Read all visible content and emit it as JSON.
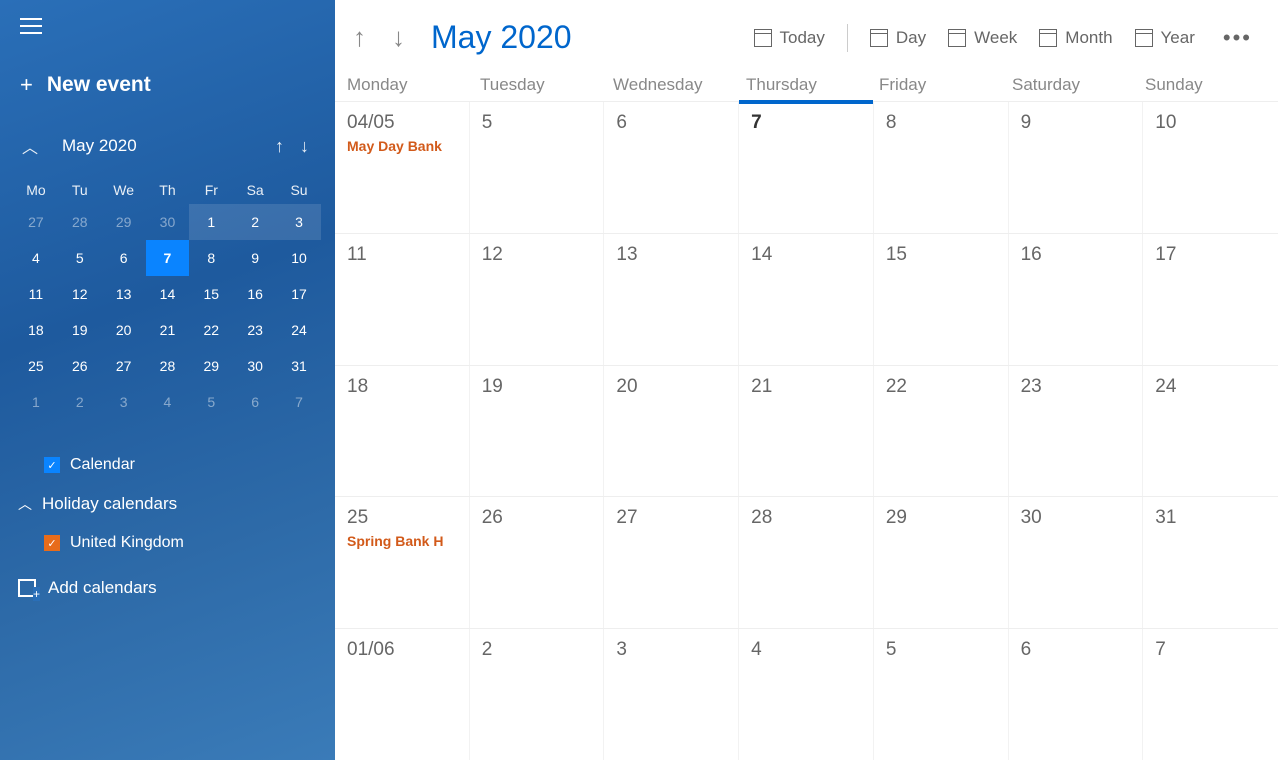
{
  "sidebar": {
    "new_event": "New event",
    "mini": {
      "label": "May 2020",
      "dow": [
        "Mo",
        "Tu",
        "We",
        "Th",
        "Fr",
        "Sa",
        "Su"
      ],
      "rows": [
        [
          {
            "d": "27",
            "o": true
          },
          {
            "d": "28",
            "o": true
          },
          {
            "d": "29",
            "o": true
          },
          {
            "d": "30",
            "o": true
          },
          {
            "d": "1",
            "w": true
          },
          {
            "d": "2",
            "w": true
          },
          {
            "d": "3",
            "w": true
          }
        ],
        [
          {
            "d": "4"
          },
          {
            "d": "5"
          },
          {
            "d": "6"
          },
          {
            "d": "7",
            "t": true
          },
          {
            "d": "8"
          },
          {
            "d": "9"
          },
          {
            "d": "10"
          }
        ],
        [
          {
            "d": "11"
          },
          {
            "d": "12"
          },
          {
            "d": "13"
          },
          {
            "d": "14"
          },
          {
            "d": "15"
          },
          {
            "d": "16"
          },
          {
            "d": "17"
          }
        ],
        [
          {
            "d": "18"
          },
          {
            "d": "19"
          },
          {
            "d": "20"
          },
          {
            "d": "21"
          },
          {
            "d": "22"
          },
          {
            "d": "23"
          },
          {
            "d": "24"
          }
        ],
        [
          {
            "d": "25"
          },
          {
            "d": "26"
          },
          {
            "d": "27"
          },
          {
            "d": "28"
          },
          {
            "d": "29"
          },
          {
            "d": "30"
          },
          {
            "d": "31"
          }
        ],
        [
          {
            "d": "1",
            "o": true
          },
          {
            "d": "2",
            "o": true
          },
          {
            "d": "3",
            "o": true
          },
          {
            "d": "4",
            "o": true
          },
          {
            "d": "5",
            "o": true
          },
          {
            "d": "6",
            "o": true
          },
          {
            "d": "7",
            "o": true
          }
        ]
      ]
    },
    "calendars": {
      "primary": "Calendar",
      "group_label": "Holiday calendars",
      "holiday_item": "United Kingdom",
      "add": "Add calendars"
    }
  },
  "main": {
    "title": "May 2020",
    "views": {
      "today": "Today",
      "day": "Day",
      "week": "Week",
      "month": "Month",
      "year": "Year"
    },
    "dow": [
      "Monday",
      "Tuesday",
      "Wednesday",
      "Thursday",
      "Friday",
      "Saturday",
      "Sunday"
    ],
    "weeks": [
      [
        {
          "d": "04/05",
          "e": "May Day Bank"
        },
        {
          "d": "5"
        },
        {
          "d": "6"
        },
        {
          "d": "7",
          "t": true
        },
        {
          "d": "8"
        },
        {
          "d": "9"
        },
        {
          "d": "10"
        }
      ],
      [
        {
          "d": "11"
        },
        {
          "d": "12"
        },
        {
          "d": "13"
        },
        {
          "d": "14"
        },
        {
          "d": "15"
        },
        {
          "d": "16"
        },
        {
          "d": "17"
        }
      ],
      [
        {
          "d": "18"
        },
        {
          "d": "19"
        },
        {
          "d": "20"
        },
        {
          "d": "21"
        },
        {
          "d": "22"
        },
        {
          "d": "23"
        },
        {
          "d": "24"
        }
      ],
      [
        {
          "d": "25",
          "e": "Spring Bank H"
        },
        {
          "d": "26"
        },
        {
          "d": "27"
        },
        {
          "d": "28"
        },
        {
          "d": "29"
        },
        {
          "d": "30"
        },
        {
          "d": "31"
        }
      ],
      [
        {
          "d": "01/06"
        },
        {
          "d": "2"
        },
        {
          "d": "3"
        },
        {
          "d": "4"
        },
        {
          "d": "5"
        },
        {
          "d": "6"
        },
        {
          "d": "7"
        }
      ]
    ]
  }
}
